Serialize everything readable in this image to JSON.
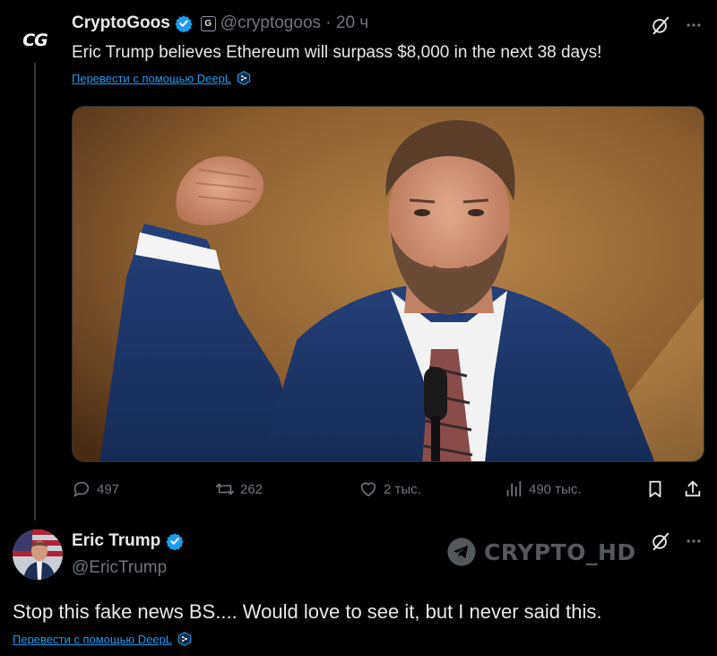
{
  "tweet1": {
    "avatar_text": "CG",
    "name": "CryptoGoos",
    "affiliate_badge": "G",
    "handle_time": "@cryptogoos · 20 ч",
    "text": "Eric Trump believes Ethereum will surpass $8,000 in the next 38 days!",
    "translate_label": "Перевести с помощью DeepL",
    "actions": {
      "replies": "497",
      "reposts": "262",
      "likes": "2 тыс.",
      "views": "490 тыс."
    }
  },
  "tweet2": {
    "name": "Eric Trump",
    "handle": "@EricTrump",
    "text": "Stop this fake news BS.... Would love to see it, but I never said this.",
    "translate_label": "Перевести с помощью DeepL"
  },
  "watermark": "CRYPTO_HD",
  "colors": {
    "background": "#000000",
    "primary_text": "#e7e9ea",
    "secondary_text": "#71767b",
    "link": "#1d9bf0",
    "verified": "#1d9bf0"
  },
  "icons": [
    "grok-icon",
    "more-icon",
    "reply-icon",
    "repost-icon",
    "like-icon",
    "views-icon",
    "bookmark-icon",
    "share-icon",
    "verified-icon",
    "deepl-icon",
    "telegram-icon"
  ]
}
